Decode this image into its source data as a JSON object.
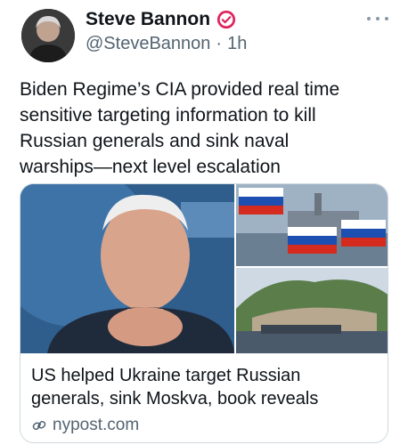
{
  "author": {
    "name": "Steve Bannon",
    "handle": "@SteveBannon",
    "separator": "·",
    "time": "1h",
    "verified_badge_color": "#e0245e"
  },
  "post": {
    "text": "Biden Regime’s CIA provided real time\nsensitive targeting information to kill\nRussian generals and sink naval\nwarships—next level escalation"
  },
  "card": {
    "title": "US helped Ukraine target Russian\ngenerals, sink Moskva, book reveals",
    "domain": "nypost.com"
  },
  "icons": {
    "more": "more-horizontal-icon",
    "verified": "verified-badge-icon",
    "link": "link-icon"
  },
  "colors": {
    "text_primary": "#0f1419",
    "text_secondary": "#536471",
    "border": "#cfd9de"
  }
}
